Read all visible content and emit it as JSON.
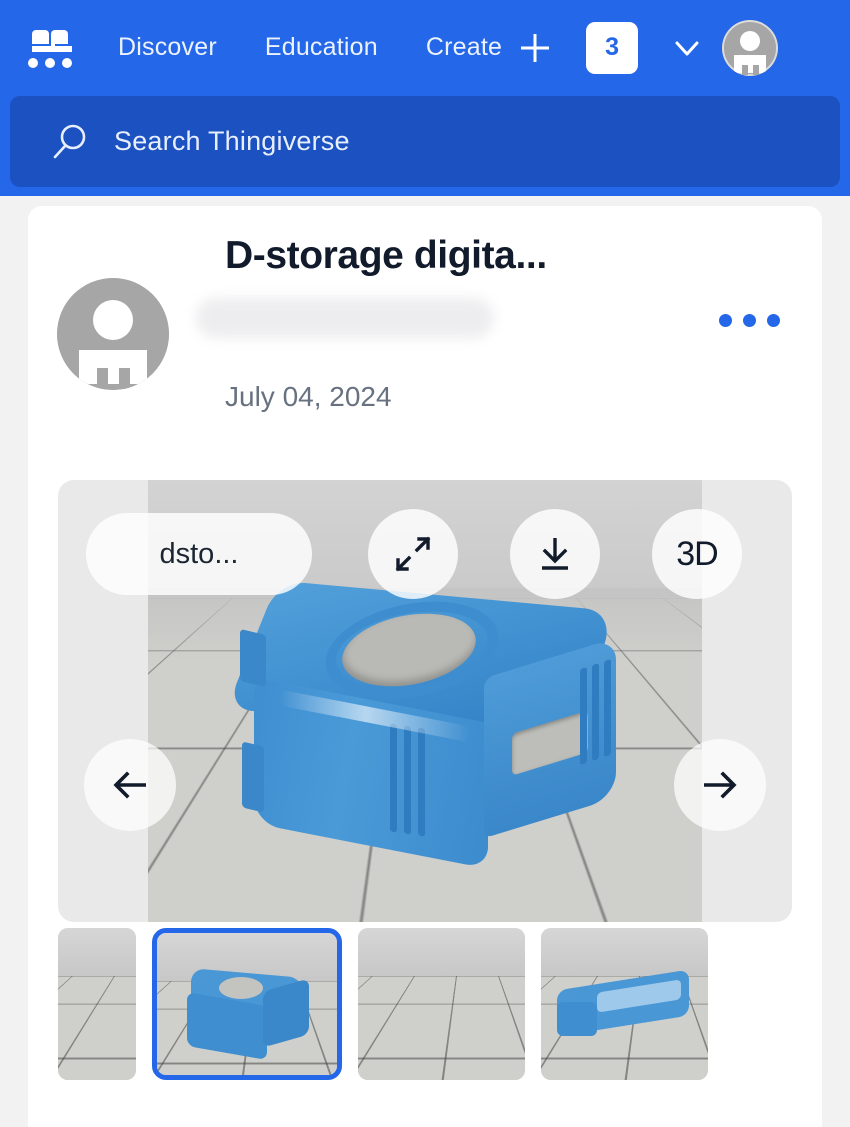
{
  "header": {
    "brand_logo_icon": "thingiverse-logo-icon",
    "nav": [
      {
        "label": "Discover",
        "name": "nav-discover"
      },
      {
        "label": "Education",
        "name": "nav-education"
      },
      {
        "label": "Create",
        "name": "nav-create"
      }
    ],
    "create_plus_icon": "plus-icon",
    "notification_count": "3",
    "account_chevron_icon": "chevron-down-icon",
    "account_avatar_icon": "user-avatar-icon",
    "background_color": "#2467e8"
  },
  "search": {
    "placeholder": "Search Thingiverse",
    "value": "",
    "icon": "search-icon",
    "background_color": "#1b51c0"
  },
  "thing": {
    "title": "D-storage digita...",
    "author": "",
    "author_redacted": true,
    "date": "July 04, 2024",
    "avatar_icon": "user-avatar-icon",
    "more_menu_icon": "ellipsis-icon",
    "accent_color": "#2467e8"
  },
  "viewer": {
    "file_name_label": "dsto...",
    "expand_icon": "expand-arrows-icon",
    "download_icon": "download-icon",
    "three_d_label": "3D",
    "prev_icon": "arrow-left-icon",
    "next_icon": "arrow-right-icon"
  },
  "thumbnails": [
    {
      "name": "thumbnail-1",
      "selected": false
    },
    {
      "name": "thumbnail-2",
      "selected": true
    },
    {
      "name": "thumbnail-3",
      "selected": false
    },
    {
      "name": "thumbnail-4",
      "selected": false
    }
  ]
}
